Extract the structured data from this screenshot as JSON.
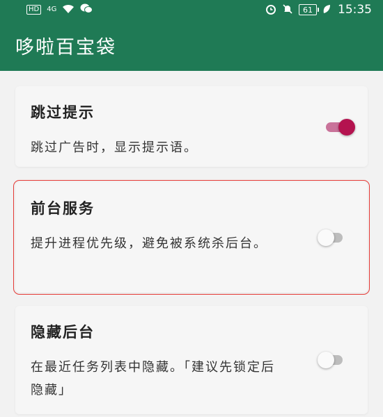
{
  "status_bar": {
    "hd_label": "HD",
    "signal_label": "4G",
    "battery_level": "61",
    "time": "15:35",
    "icons": [
      "wifi-icon",
      "wechat-icon",
      "alarm-icon",
      "mute-icon",
      "battery-icon",
      "leaf-icon"
    ]
  },
  "app_bar": {
    "title": "哆啦百宝袋",
    "color": "#1f7a55"
  },
  "settings": [
    {
      "title": "跳过提示",
      "description": "跳过广告时，显示提示语。",
      "enabled": true
    },
    {
      "title": "前台服务",
      "description": "提升进程优先级，避免被系统杀后台。",
      "enabled": false,
      "highlighted": true
    },
    {
      "title": "隐藏后台",
      "description": "在最近任务列表中隐藏。「建议先锁定后隐藏」",
      "enabled": false
    }
  ],
  "colors": {
    "accent": "#b4134f",
    "highlight_border": "#e53935"
  }
}
